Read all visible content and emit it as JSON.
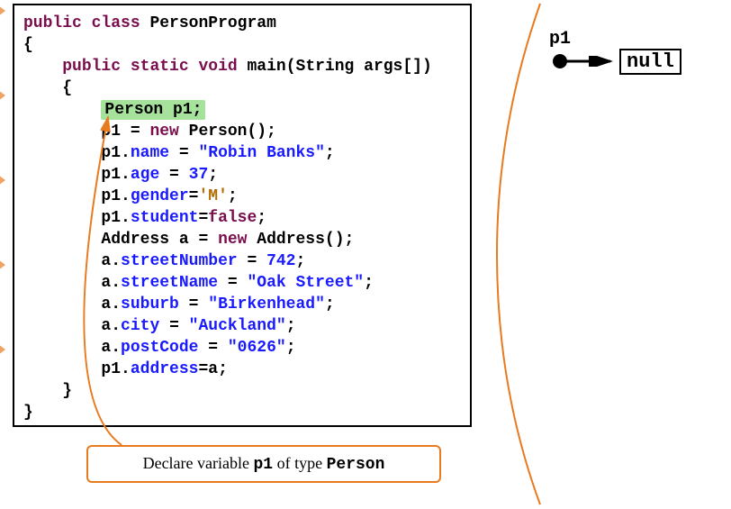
{
  "code": {
    "class_decl_public": "public",
    "class_decl_class": "class",
    "class_name": "PersonProgram",
    "open_brace1": "{",
    "main_sig_public": "public",
    "main_sig_static": "static",
    "main_sig_void": "void",
    "main_name": "main",
    "main_param_type": "String",
    "main_param_name": "args[]",
    "open_brace2": "{",
    "hl_type": "Person",
    "hl_var": "p1;",
    "l1_var": "p1",
    "l1_eq": " = ",
    "l1_new": "new",
    "l1_ctor": " Person();",
    "l2_var": "p1",
    "l2_dot": ".",
    "l2_field": "name",
    "l2_eq": " = ",
    "l2_val": "\"Robin Banks\"",
    "l2_semi": ";",
    "l3_var": "p1",
    "l3_field": "age",
    "l3_val": "37",
    "l4_var": "p1",
    "l4_field": "gender",
    "l4_val": "'M'",
    "l5_var": "p1",
    "l5_field": "student",
    "l5_val": "false",
    "l6_type": "Address",
    "l6_var": "a",
    "l6_new": "new",
    "l6_ctor": "Address();",
    "l7_var": "a",
    "l7_field": "streetNumber",
    "l7_val": "742",
    "l8_var": "a",
    "l8_field": "streetName",
    "l8_val": "\"Oak Street\"",
    "l9_var": "a",
    "l9_field": "suburb",
    "l9_val": "\"Birkenhead\"",
    "l10_var": "a",
    "l10_field": "city",
    "l10_val": "\"Auckland\"",
    "l11_var": "a",
    "l11_field": "postCode",
    "l11_val": "\"0626\"",
    "l12_var": "p1",
    "l12_field": "address",
    "l12_val": "a",
    "close_brace2": "}",
    "close_brace1": "}"
  },
  "caption": {
    "pre": "Declare variable ",
    "var": "p1",
    "mid": " of type ",
    "type": "Person"
  },
  "diagram": {
    "var_label": "p1",
    "value": "null"
  },
  "colors": {
    "keyword": "#7a0e4d",
    "field": "#1a1aff",
    "highlight_bg": "#a6e29b",
    "callout_border": "#e87a1f"
  }
}
